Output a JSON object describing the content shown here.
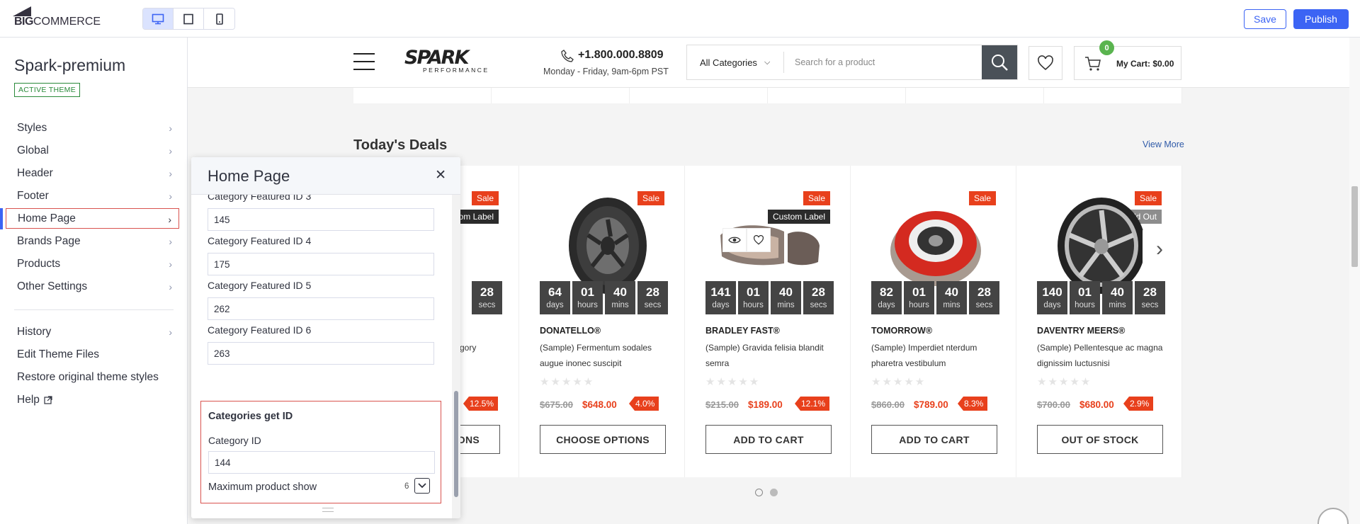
{
  "topbar": {
    "logo_bold": "BIG",
    "logo_rest": "COMMERCE",
    "devices": [
      "desktop-icon",
      "tablet-icon",
      "mobile-icon"
    ],
    "save_label": "Save",
    "publish_label": "Publish"
  },
  "sidebar": {
    "theme_name": "Spark-premium",
    "badge": "ACTIVE THEME",
    "items": [
      {
        "label": "Styles"
      },
      {
        "label": "Global"
      },
      {
        "label": "Header"
      },
      {
        "label": "Footer"
      },
      {
        "label": "Home Page"
      },
      {
        "label": "Brands Page"
      },
      {
        "label": "Products"
      },
      {
        "label": "Other Settings"
      }
    ],
    "bottom_items": [
      {
        "label": "History"
      },
      {
        "label": "Edit Theme Files"
      },
      {
        "label": "Restore original theme styles"
      },
      {
        "label": "Help"
      }
    ]
  },
  "panel": {
    "title": "Home Page",
    "fields": [
      {
        "label": "Category Featured ID 3",
        "value": "145"
      },
      {
        "label": "Category Featured ID 4",
        "value": "175"
      },
      {
        "label": "Category Featured ID 5",
        "value": "262"
      },
      {
        "label": "Category Featured ID 6",
        "value": "263"
      }
    ],
    "group": {
      "title": "Categories get ID",
      "field_label": "Category ID",
      "field_value": "144",
      "max_label": "Maximum product show",
      "max_value": "6"
    }
  },
  "site": {
    "logo_word": "SPARK",
    "logo_sub": "PERFORMANCE",
    "phone": "+1.800.000.8809",
    "hours": "Monday - Friday, 9am-6pm PST",
    "search_category": "All Categories",
    "search_placeholder": "Search for a product",
    "cart_count": "0",
    "cart_label": "My Cart: $0.00",
    "deals_title": "Today's Deals",
    "view_more": "View More",
    "colors": {
      "sale": "#e8401c",
      "accent": "#3c64f4"
    }
  },
  "products": [
    {
      "sale": "Sale",
      "tag": "Custom Label",
      "countdown": [
        [
          "",
          ""
        ],
        [
          "",
          ""
        ],
        [
          "",
          ""
        ],
        [
          "28",
          "secs"
        ]
      ],
      "brand": "",
      "name": "tegory",
      "stars": "",
      "old": "",
      "new": "",
      "discount": "12.5%",
      "cta": "ONS"
    },
    {
      "sale": "Sale",
      "tag": "",
      "countdown": [
        [
          "64",
          "days"
        ],
        [
          "01",
          "hours"
        ],
        [
          "40",
          "mins"
        ],
        [
          "28",
          "secs"
        ]
      ],
      "brand": "DONATELLO®",
      "name": "(Sample) Fermentum sodales augue inonec suscipit",
      "stars": "★★★★★",
      "old": "$675.00",
      "new": "$648.00",
      "discount": "4.0%",
      "cta": "CHOOSE OPTIONS"
    },
    {
      "sale": "Sale",
      "tag": "Custom Label",
      "countdown": [
        [
          "141",
          "days"
        ],
        [
          "01",
          "hours"
        ],
        [
          "40",
          "mins"
        ],
        [
          "28",
          "secs"
        ]
      ],
      "brand": "BRADLEY FAST®",
      "name": "(Sample) Gravida felisia blandit semra",
      "stars": "★★★★★",
      "old": "$215.00",
      "new": "$189.00",
      "discount": "12.1%",
      "cta": "ADD TO CART"
    },
    {
      "sale": "Sale",
      "tag": "",
      "countdown": [
        [
          "82",
          "days"
        ],
        [
          "01",
          "hours"
        ],
        [
          "40",
          "mins"
        ],
        [
          "28",
          "secs"
        ]
      ],
      "brand": "TOMORROW®",
      "name": "(Sample) Imperdiet nterdum pharetra vestibulum",
      "stars": "★★★★★",
      "old": "$860.00",
      "new": "$789.00",
      "discount": "8.3%",
      "cta": "ADD TO CART"
    },
    {
      "sale": "Sale",
      "tag": "Sold Out",
      "countdown": [
        [
          "140",
          "days"
        ],
        [
          "01",
          "hours"
        ],
        [
          "40",
          "mins"
        ],
        [
          "28",
          "secs"
        ]
      ],
      "brand": "DAVENTRY MEERS®",
      "name": "(Sample) Pellentesque ac magna dignissim luctusnisi",
      "stars": "★★★★★",
      "old": "$700.00",
      "new": "$680.00",
      "discount": "2.9%",
      "cta": "OUT OF STOCK"
    }
  ]
}
